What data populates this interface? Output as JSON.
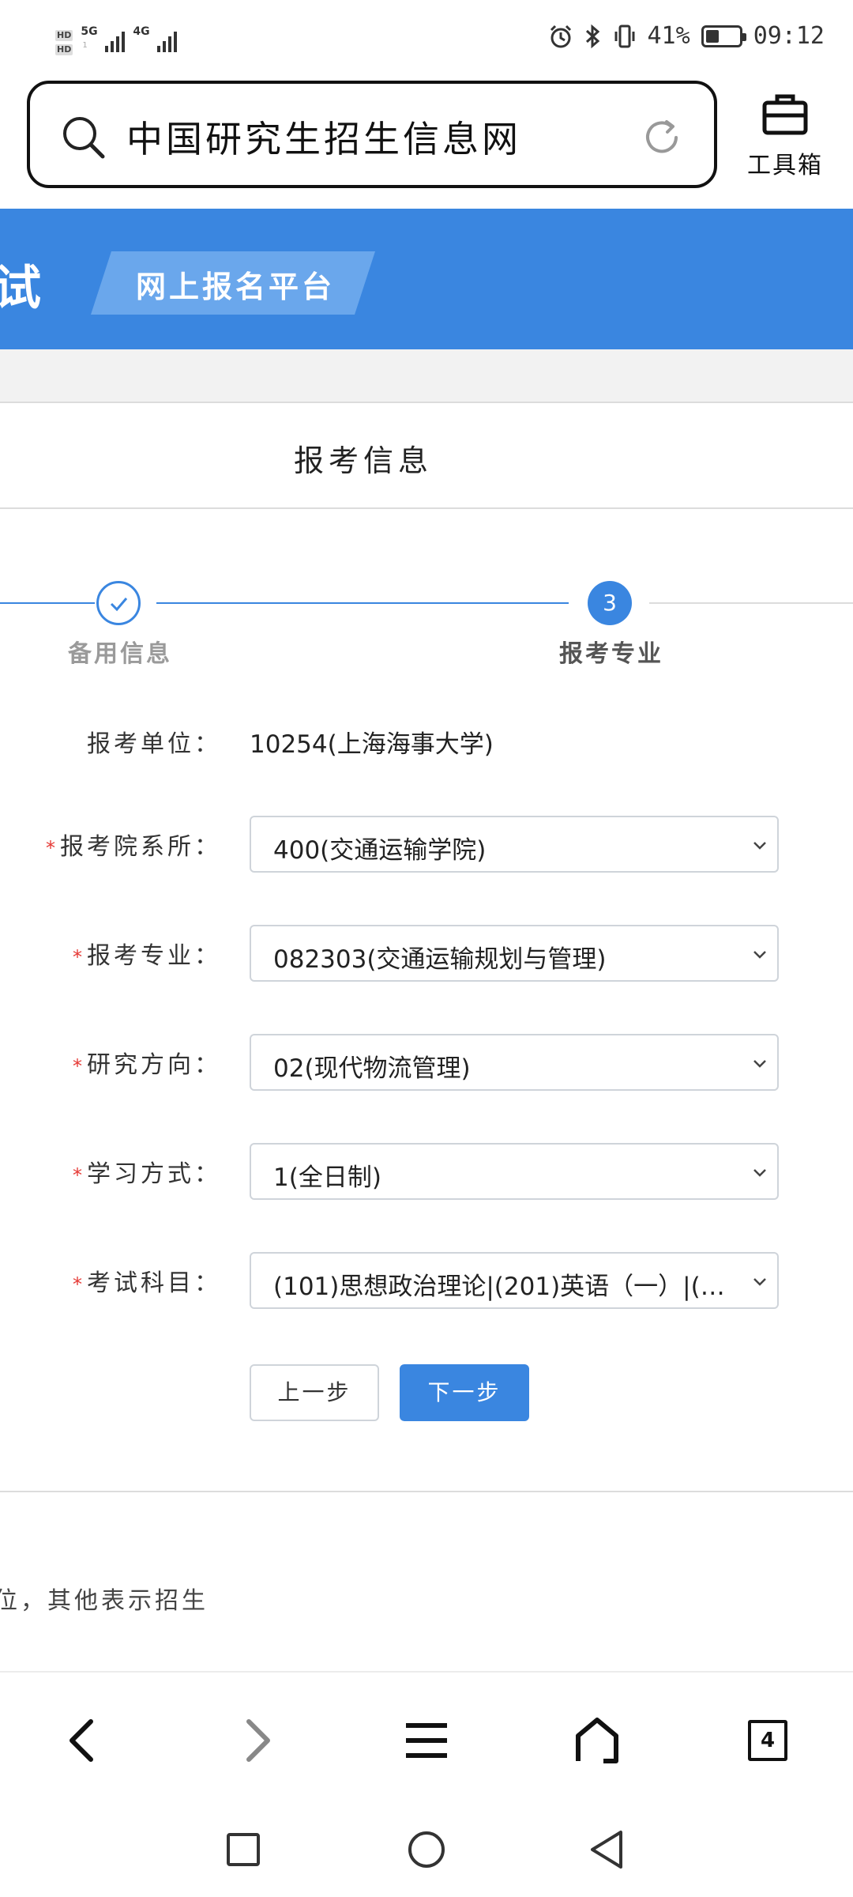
{
  "status_bar": {
    "net_top": "5G",
    "net_bottom": "4G",
    "sub_top": "1",
    "hd": "HD",
    "battery_percent_text": "41%",
    "battery_level": 0.41,
    "time": "09:12"
  },
  "browser": {
    "url_text": "中国研究生招生信息网",
    "toolbox_label": "工具箱",
    "tabs_count": "4"
  },
  "header": {
    "left_partial_char": "试",
    "tab_label": "网上报名平台"
  },
  "section": {
    "title": "报考信息"
  },
  "steps": {
    "done_label": "备用信息",
    "current_number": "3",
    "current_label": "报考专业"
  },
  "form": {
    "unit_label": "报考单位：",
    "unit_value": "10254(上海海事大学)",
    "required_mark": "*",
    "dept_label": "报考院系所：",
    "dept_value": "400(交通运输学院)",
    "major_label": "报考专业：",
    "major_value": "082303(交通运输规划与管理)",
    "direction_label": "研究方向：",
    "direction_value": "02(现代物流管理)",
    "mode_label": "学习方式：",
    "mode_value": "1(全日制)",
    "subjects_label": "考试科目：",
    "subjects_value": "(101)思想政治理论|(201)英语（一）|(301..."
  },
  "buttons": {
    "prev": "上一步",
    "next": "下一步"
  },
  "note": "位，其他表示招生",
  "colors": {
    "primary": "#3a86e0",
    "header_tab": "#6aa7ec",
    "required": "#e53935"
  }
}
